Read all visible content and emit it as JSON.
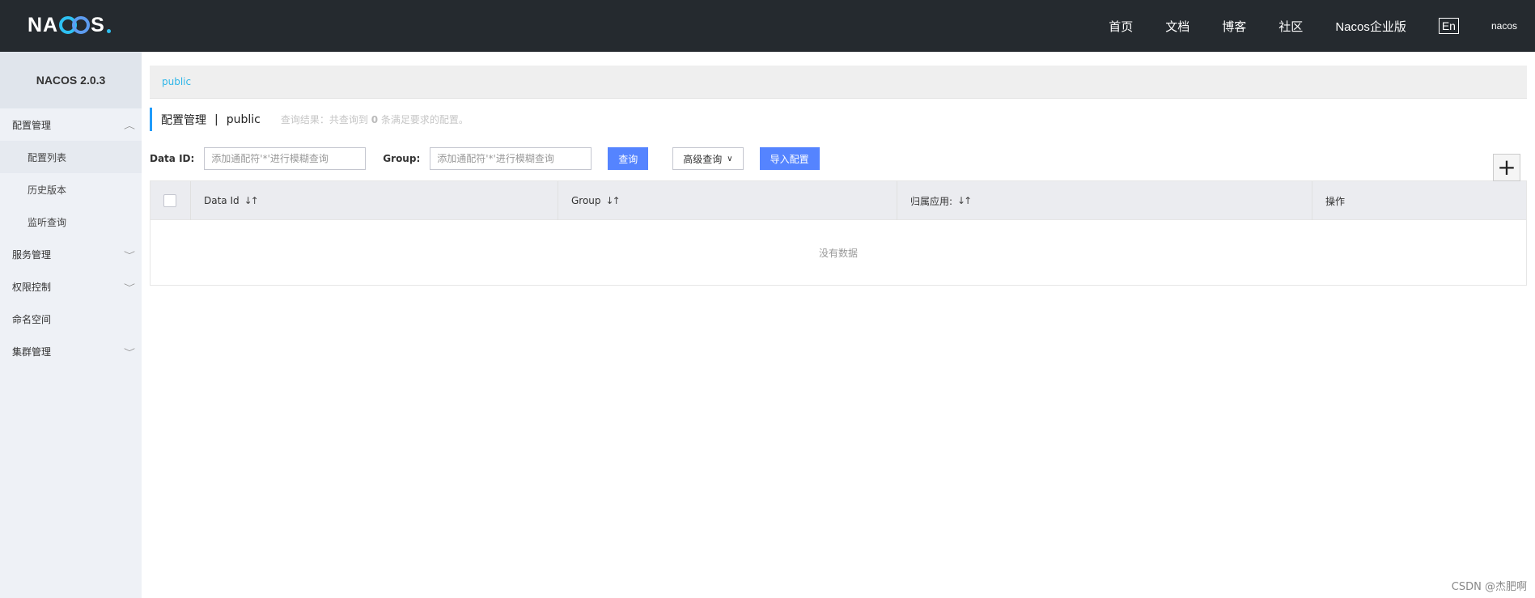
{
  "header": {
    "logo_prefix": "NA",
    "logo_suffix": "S",
    "nav": [
      "首页",
      "文档",
      "博客",
      "社区",
      "Nacos企业版"
    ],
    "lang": "En",
    "user": "nacos"
  },
  "sidebar": {
    "version": "NACOS 2.0.3",
    "config_group": "配置管理",
    "config_items": [
      "配置列表",
      "历史版本",
      "监听查询"
    ],
    "service_group": "服务管理",
    "auth_group": "权限控制",
    "namespace": "命名空间",
    "cluster_group": "集群管理"
  },
  "main": {
    "namespace_tab": "public",
    "title": "配置管理",
    "separator": "|",
    "current_ns": "public",
    "result_prefix": "查询结果：共查询到",
    "result_count": "0",
    "result_suffix": "条满足要求的配置。",
    "dataid_label": "Data ID:",
    "dataid_placeholder": "添加通配符'*'进行模糊查询",
    "group_label": "Group:",
    "group_placeholder": "添加通配符'*'进行模糊查询",
    "query_button": "查询",
    "advanced_button": "高级查询",
    "import_button": "导入配置",
    "add_button": "+",
    "columns": [
      "Data Id",
      "Group",
      "归属应用:",
      "操作"
    ],
    "empty_text": "没有数据"
  },
  "watermark": "CSDN @杰肥啊"
}
